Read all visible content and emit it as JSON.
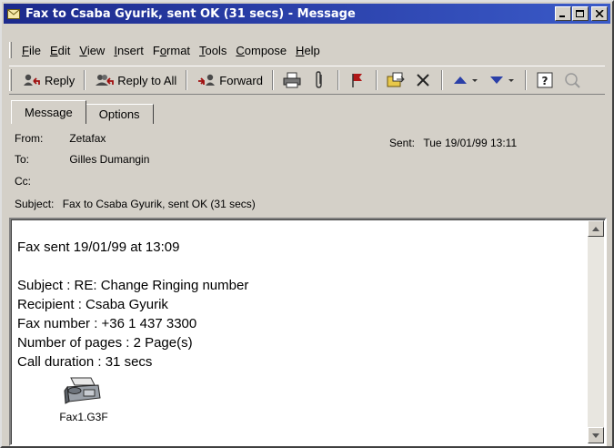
{
  "window": {
    "title": "Fax to Csaba Gyurik, sent OK (31 secs) - Message"
  },
  "menu": [
    {
      "label": "File",
      "key": "F"
    },
    {
      "label": "Edit",
      "key": "E"
    },
    {
      "label": "View",
      "key": "V"
    },
    {
      "label": "Insert",
      "key": "I"
    },
    {
      "label": "Format",
      "key": "o"
    },
    {
      "label": "Tools",
      "key": "T"
    },
    {
      "label": "Compose",
      "key": "C"
    },
    {
      "label": "Help",
      "key": "H"
    }
  ],
  "toolbar": {
    "reply_label": "Reply",
    "reply_all_label": "Reply to All",
    "forward_label": "Forward"
  },
  "tabs": [
    {
      "label": "Message",
      "active": true
    },
    {
      "label": "Options",
      "active": false
    }
  ],
  "header": {
    "from_label": "From:",
    "from_value": "Zetafax",
    "to_label": "To:",
    "to_value": "Gilles Dumangin",
    "cc_label": "Cc:",
    "cc_value": "",
    "subject_label": "Subject:",
    "subject_value": "Fax to Csaba Gyurik, sent OK (31 secs)",
    "sent_label": "Sent:",
    "sent_value": "Tue 19/01/99 13:11"
  },
  "body": {
    "line1": "Fax sent    19/01/99 at 13:09",
    "subject": "Subject : RE: Change Ringing number",
    "recipient": "Recipient : Csaba Gyurik",
    "fax_number": "Fax number : +36 1 437 3300",
    "pages": "Number of pages : 2 Page(s)",
    "duration": "Call duration : 31 secs"
  },
  "attachment": {
    "name": "Fax1.G3F",
    "icon": "fax-machine-icon"
  },
  "colors": {
    "titlebar": "#1c2a8c",
    "face": "#d4d0c8",
    "body_bg": "#ffffff"
  }
}
